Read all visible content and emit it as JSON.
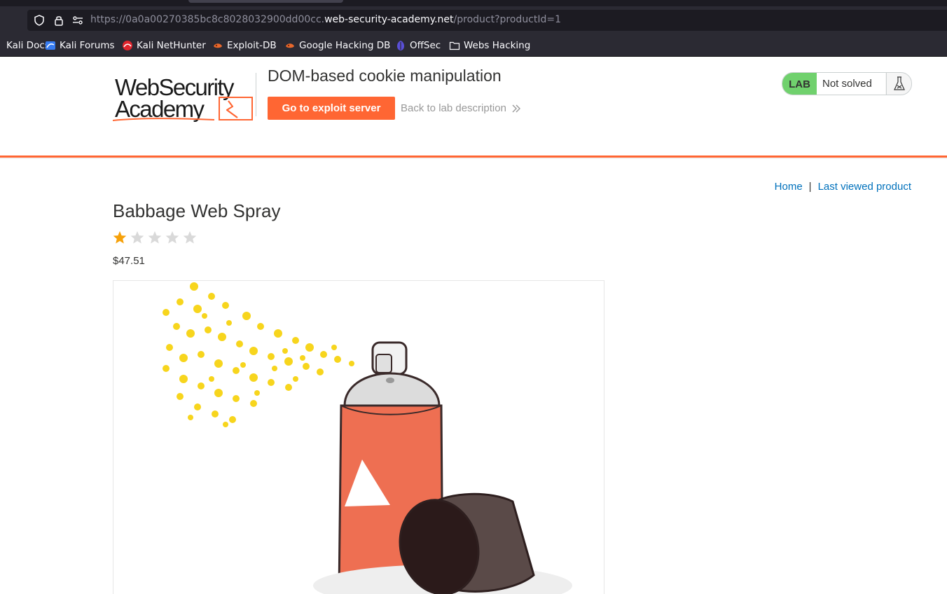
{
  "browser": {
    "url_prefix": "https://0a0a00270385bc8c8028032900dd00cc.",
    "url_domain": "web-security-academy.net",
    "url_path": "/product?productId=1",
    "bookmarks": [
      {
        "label": "Kali Docs",
        "icon": "kali-icon"
      },
      {
        "label": "Kali Forums",
        "icon": "kali-forums-icon"
      },
      {
        "label": "Kali NetHunter",
        "icon": "nethunter-icon"
      },
      {
        "label": "Exploit-DB",
        "icon": "exploitdb-icon"
      },
      {
        "label": "Google Hacking DB",
        "icon": "exploitdb-icon"
      },
      {
        "label": "OffSec",
        "icon": "offsec-icon"
      },
      {
        "label": "Webs Hacking",
        "icon": "folder-icon"
      }
    ]
  },
  "header": {
    "logo_line1": "WebSecurity",
    "logo_line2": "Academy",
    "lab_title": "DOM-based cookie manipulation",
    "exploit_button": "Go to exploit server",
    "back_link": "Back to lab description",
    "badge_label": "LAB",
    "badge_status": "Not solved"
  },
  "nav": {
    "home": "Home",
    "separator": "|",
    "last_viewed": "Last viewed product"
  },
  "product": {
    "title": "Babbage Web Spray",
    "rating": 1,
    "rating_max": 5,
    "price": "$47.51"
  },
  "colors": {
    "accent": "#ff6633",
    "link": "#0071bc",
    "lab_green": "#70d16d",
    "star_filled": "#f6a10a",
    "star_empty": "#d9d9d9"
  }
}
